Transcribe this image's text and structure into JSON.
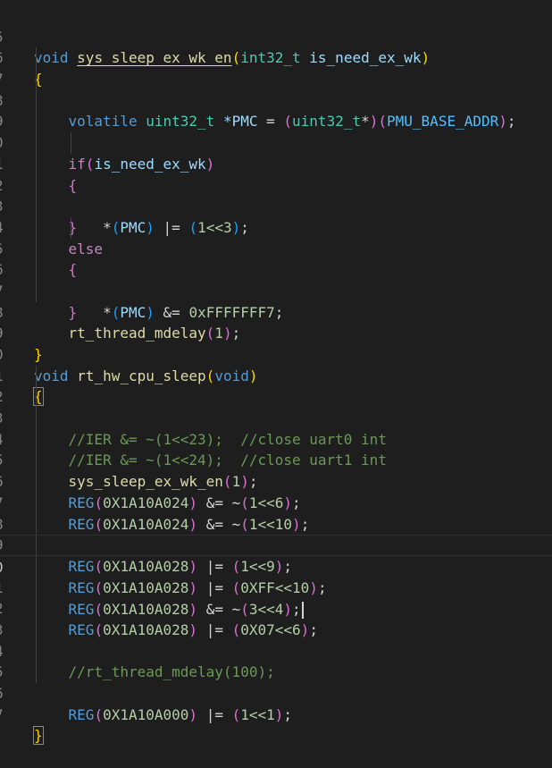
{
  "gutter": [
    "5",
    "6",
    "7",
    "8",
    "9",
    "0",
    "1",
    "2",
    "3",
    "4",
    "5",
    "6",
    "7",
    "8",
    "9",
    "0",
    "1",
    "2",
    "3",
    "4",
    "5",
    "6",
    "7",
    "8",
    "9",
    "0",
    "1",
    "2",
    "3",
    "4",
    "5",
    "6",
    "7",
    "8"
  ],
  "code": {
    "func1_kw": "void",
    "func1_name": "sys_sleep_ex_wk_en",
    "func1_paren_open": "(",
    "func1_param_type": "int32_t",
    "func1_param_name": "is_need_ex_wk",
    "func1_paren_close": ")",
    "brace_open": "{",
    "brace_close": "}",
    "volatile_kw": "volatile",
    "uint32_type": "uint32_t",
    "pmc_decl": "*PMC",
    "assign": "=",
    "cast_open": "(",
    "cast_type": "uint32_t",
    "cast_star": "*",
    "cast_close": ")",
    "paren_open": "(",
    "pmu_base": "PMU_BASE_ADDR",
    "paren_close": ")",
    "semicolon": ";",
    "if_kw": "if",
    "if_open": "(",
    "if_var": "is_need_ex_wk",
    "if_close": ")",
    "deref_star": "*",
    "pmc_open": "(",
    "pmc_name": "PMC",
    "pmc_close": ")",
    "or_assign": "|=",
    "and_assign": "&=",
    "one_shl_3": "1<<3",
    "mask_value": "0xFFFFFFF7",
    "else_kw": "else",
    "mdelay_fn": "rt_thread_mdelay",
    "mdelay_open": "(",
    "mdelay_arg": "1",
    "mdelay_close": ")",
    "func2_kw": "void",
    "func2_name": "rt_hw_cpu_sleep",
    "func2_open": "(",
    "func2_param": "void",
    "func2_close": ")",
    "comment_ier23": "//IER &= ~(1<<23);  //close uart0 int",
    "comment_ier24": "//IER &= ~(1<<24);  //close uart1 int",
    "call_fn": "sys_sleep_ex_wk_en",
    "call_open": "(",
    "call_arg": "1",
    "call_close": ")",
    "reg_fn": "REG",
    "addr_a024": "0X1A10A024",
    "addr_a028": "0X1A10A028",
    "addr_a000": "0X1A10A000",
    "tilde": "~",
    "expr_1shl6": "1<<6",
    "expr_1shl10": "1<<10",
    "expr_1shl9": "1<<9",
    "expr_0xff": "0XFF<<10",
    "expr_3shl4": "3<<4",
    "expr_0x07": "0X07<<6",
    "expr_1shl1": "1<<1",
    "comment_mdelay": "//rt_thread_mdelay(100);"
  }
}
